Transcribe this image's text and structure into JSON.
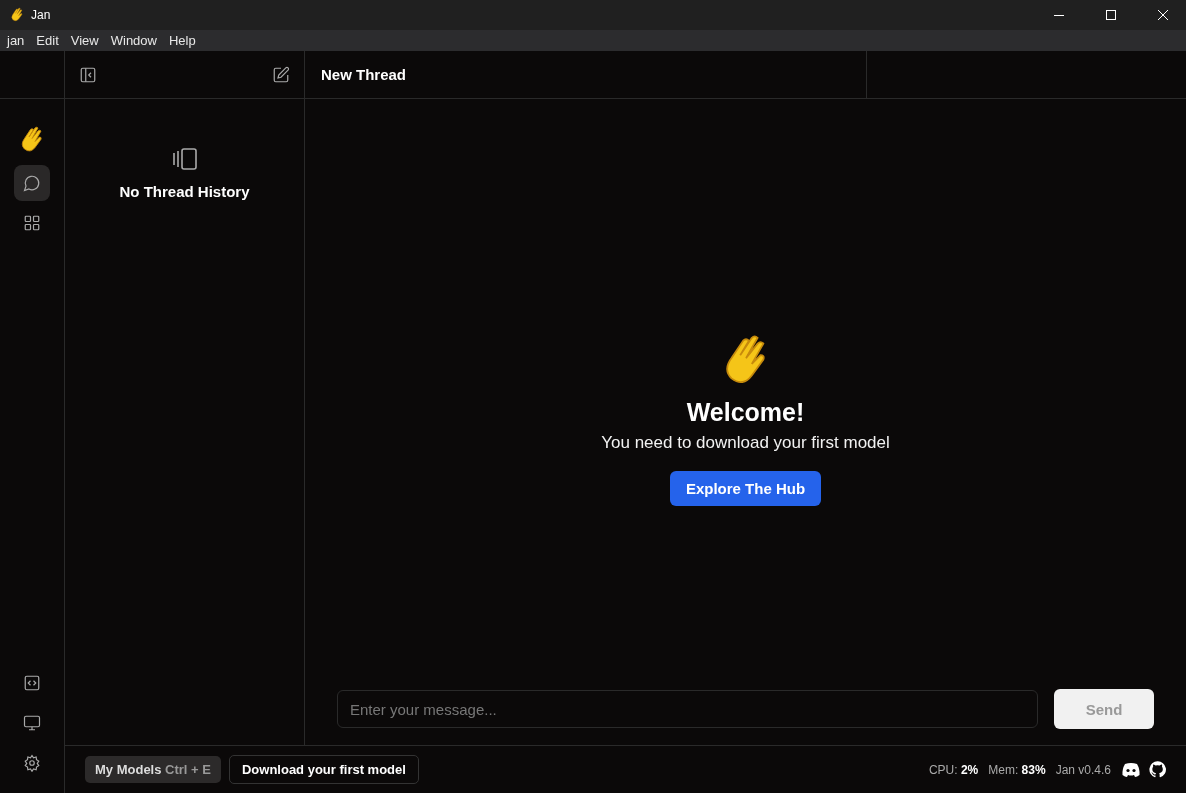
{
  "window": {
    "title": "Jan"
  },
  "menu": [
    "jan",
    "Edit",
    "View",
    "Window",
    "Help"
  ],
  "topbar": {
    "title": "New Thread"
  },
  "rail": {
    "nav": [
      {
        "selected": true
      },
      {
        "selected": false
      }
    ]
  },
  "threads": {
    "empty_text": "No Thread History"
  },
  "welcome": {
    "title": "Welcome!",
    "subtitle": "You need to download your first model",
    "button": "Explore The Hub"
  },
  "composer": {
    "placeholder": "Enter your message...",
    "send": "Send",
    "send_disabled": true
  },
  "status_bar": {
    "models_label": "My Models",
    "shortcut": "Ctrl + E",
    "download": "Download your first model",
    "stats": [
      "CPU: **2%**",
      "Mem: **83%**"
    ],
    "version": "Jan v0.4.6"
  }
}
